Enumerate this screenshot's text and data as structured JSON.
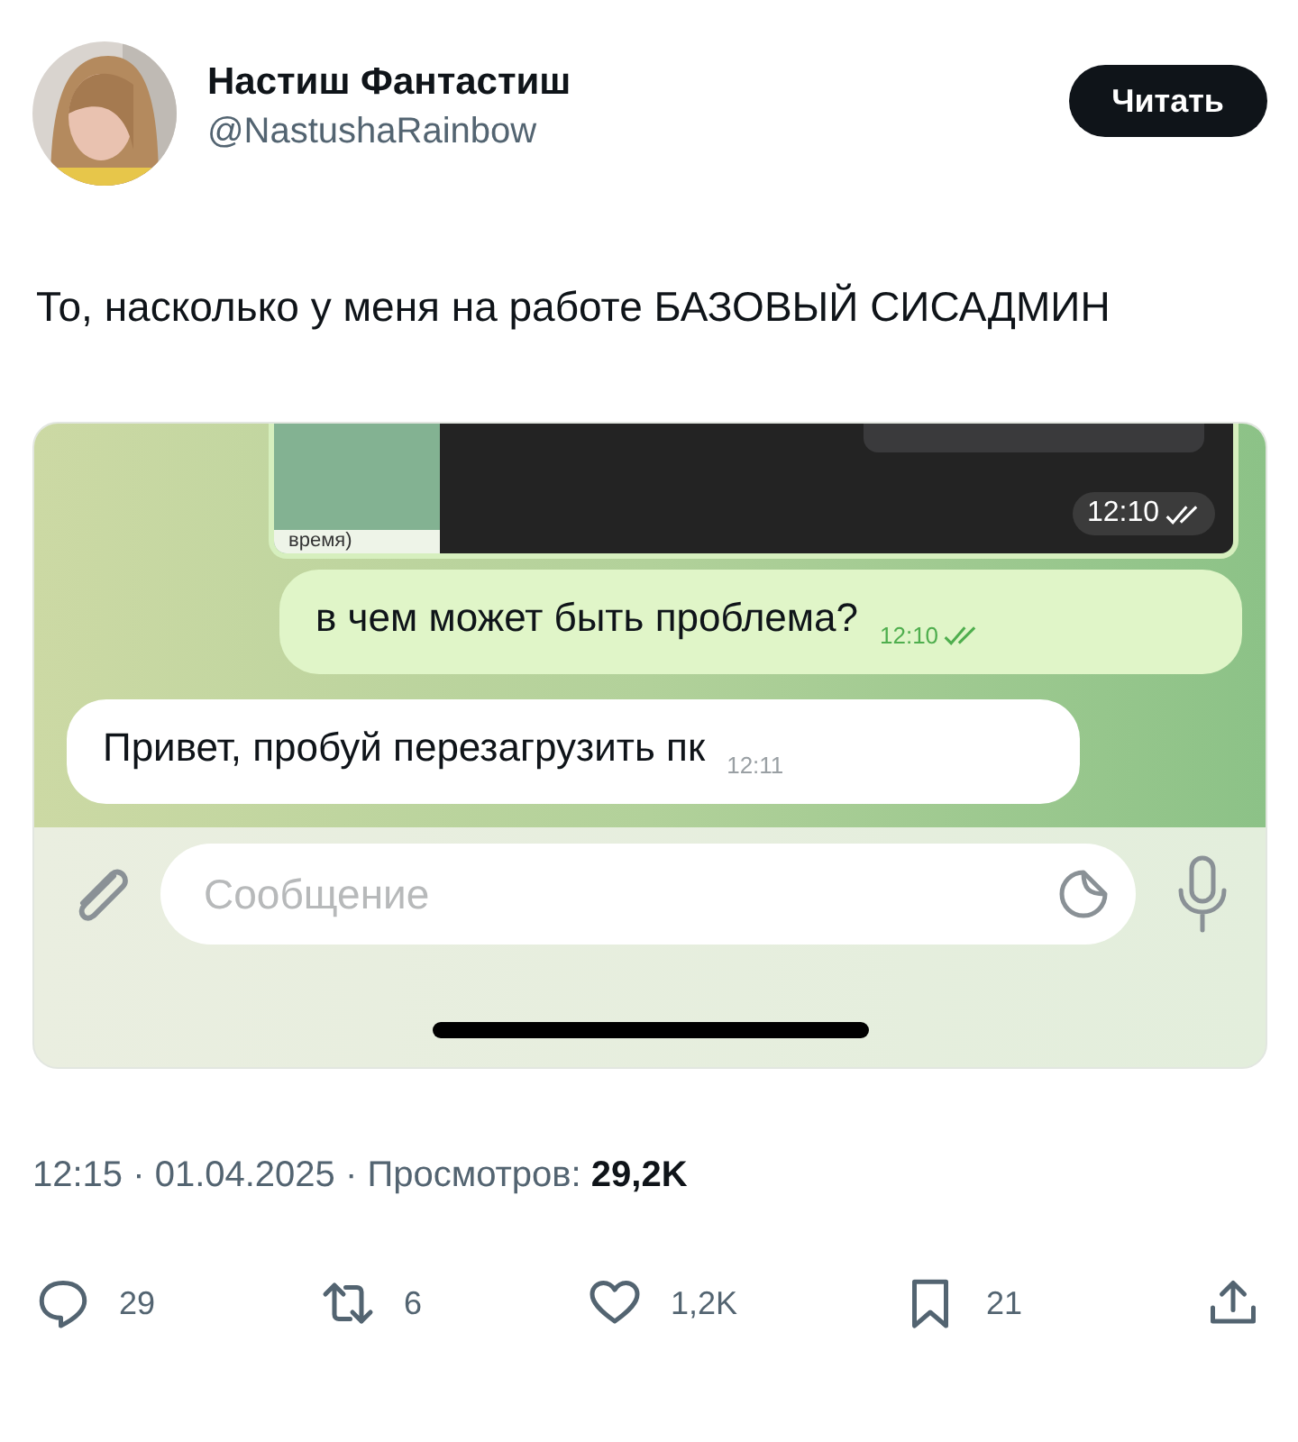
{
  "post": {
    "author": {
      "name": "Настиш Фантастиш",
      "handle": "@NastushaRainbow"
    },
    "follow_button": "Читать",
    "text": "То, насколько у меня на работе БАЗОВЫЙ СИСАДМИН",
    "media": {
      "messages": [
        {
          "fragment": "время)",
          "time": "12:10",
          "read": true
        },
        {
          "kind": "outgoing",
          "text": "в чем может быть проблема?",
          "time": "12:10",
          "read": true
        },
        {
          "kind": "incoming",
          "text": "Привет, пробуй перезагрузить пк",
          "time": "12:11"
        }
      ],
      "composer": {
        "placeholder": "Сообщение"
      }
    },
    "meta": "12:15 · 01.04.2025 · Просмотров: **29,2K**",
    "actions": [
      {
        "kind": "reply",
        "count": "29"
      },
      {
        "kind": "repost",
        "count": "6"
      },
      {
        "kind": "like",
        "count": "1,2K"
      },
      {
        "kind": "bookmark",
        "count": "21"
      },
      {
        "kind": "share"
      }
    ]
  }
}
